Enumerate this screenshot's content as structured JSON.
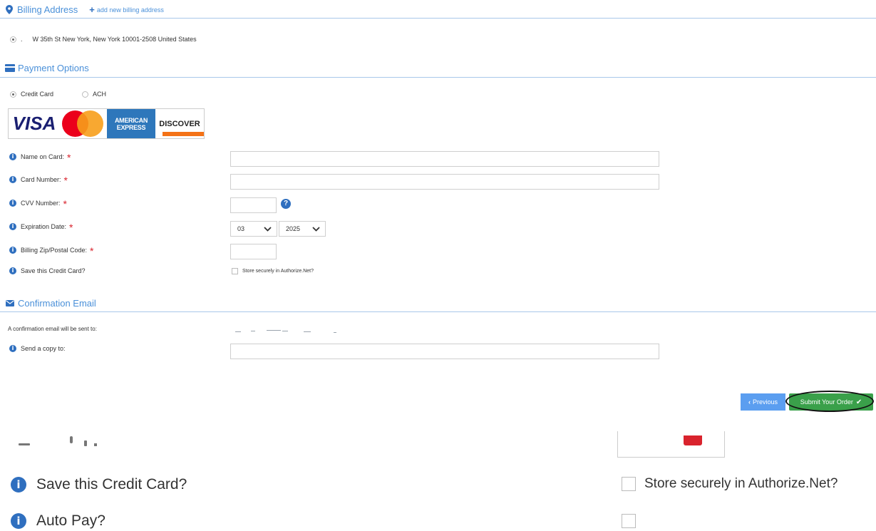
{
  "billing": {
    "title": "Billing Address",
    "add_link": "add new billing address",
    "address": "W 35th St New York, New York 10001-2508 United States",
    "address_prefix": "."
  },
  "payment": {
    "title": "Payment Options",
    "options": [
      "Credit Card",
      "ACH"
    ],
    "selected": "Credit Card",
    "card_logos": [
      "VISA",
      "AMERICAN EXPRESS",
      "DISCOVER"
    ],
    "fields": {
      "name_label": "Name on Card:",
      "card_number_label": "Card Number:",
      "cvv_label": "CVV Number:",
      "expiration_label": "Expiration Date:",
      "exp_month": "03",
      "exp_year": "2025",
      "zip_label": "Billing Zip/Postal Code:",
      "save_label": "Save this Credit Card?",
      "store_label": "Store securely in Authorize.Net?"
    }
  },
  "confirmation": {
    "title": "Confirmation Email",
    "sent_to_label": "A confirmation email will be sent to:",
    "copy_label": "Send a copy to:"
  },
  "buttons": {
    "previous": "Previous",
    "submit": "Submit Your Order"
  },
  "zoomed": {
    "save_label": "Save this Credit Card?",
    "store_label": "Store securely in Authorize.Net?",
    "autopay_label": "Auto Pay?"
  },
  "colors": {
    "accent": "#4a90d9",
    "submit": "#3aa04a",
    "previous": "#5b9ef0",
    "required": "#d9232d"
  }
}
